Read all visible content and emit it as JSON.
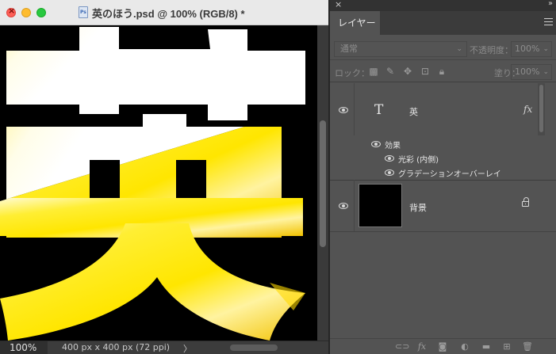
{
  "document": {
    "title": "英のほう.psd @ 100% (RGB/8) *",
    "file_icon_text": "Ps",
    "zoom": "100%",
    "doc_size": "400 px x 400 px (72 ppi)",
    "status_chevron": "〉"
  },
  "canvas": {
    "glyph": "英",
    "colors": {
      "background": "#000000",
      "top": "#ffffff",
      "bottom": "#ffe600"
    }
  },
  "panel": {
    "close": "×",
    "collapse": "››",
    "tab_label": "レイヤー",
    "blend_mode": "通常",
    "opacity_label": "不透明度：",
    "opacity_value": "100%",
    "lock_label": "ロック：",
    "fill_label": "塗り：",
    "fill_value": "100%",
    "lock_icons": [
      "lock-transparency-icon",
      "lock-paint-icon",
      "lock-move-icon",
      "lock-artboard-icon",
      "lock-all-icon"
    ],
    "layers": [
      {
        "name": "英",
        "kind": "text",
        "glyph": "T",
        "fx": "fx",
        "fx_caret": "^",
        "effects_label": "効果",
        "effects": [
          "光彩 (内側)",
          "グラデーションオーバーレイ"
        ]
      },
      {
        "name": "背景",
        "kind": "background",
        "locked": true
      }
    ],
    "footer_icons": [
      "link-icon",
      "fx-icon",
      "mask-icon",
      "adjustment-icon",
      "folder-icon",
      "new-layer-icon",
      "trash-icon"
    ],
    "footer_fx": "fx"
  }
}
